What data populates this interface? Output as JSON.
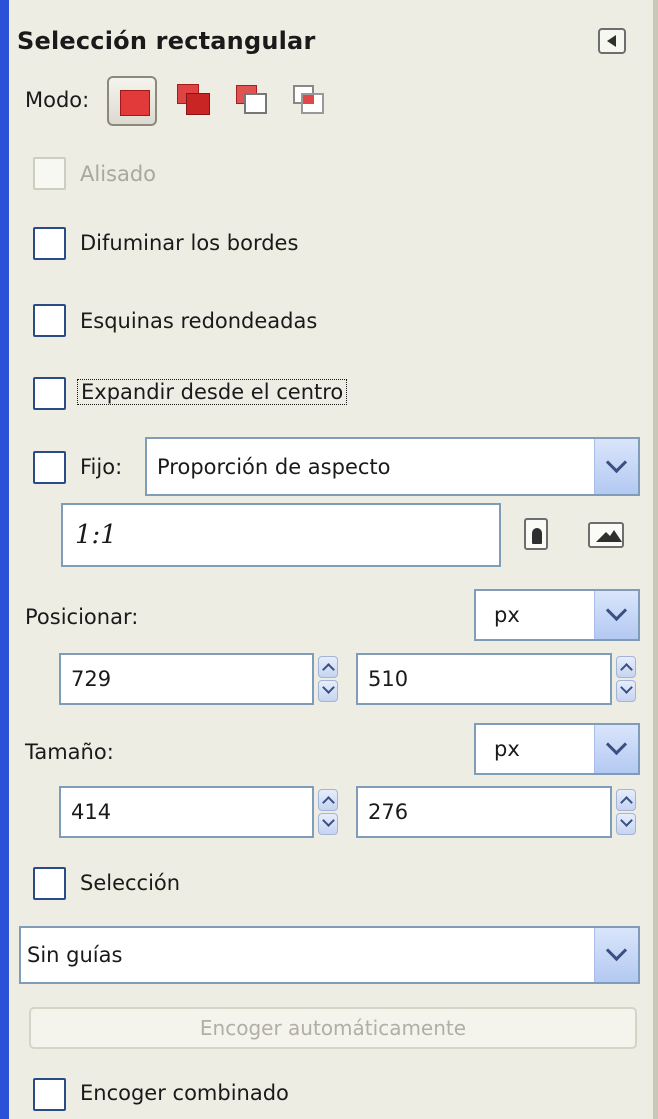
{
  "panel": {
    "title": "Selección rectangular",
    "collapse_icon": "triangle-left-icon",
    "mode_label": "Modo:",
    "modes": [
      "replace-selection-icon",
      "add-selection-icon",
      "subtract-selection-icon",
      "intersect-selection-icon"
    ],
    "active_mode": "replace-selection-icon"
  },
  "options": {
    "antialias": {
      "label": "Alisado",
      "checked": false,
      "enabled": false
    },
    "feather": {
      "label": "Difuminar los bordes",
      "checked": false
    },
    "rounded": {
      "label": "Esquinas redondeadas",
      "checked": false
    },
    "expand": {
      "label": "Expandir desde el centro",
      "checked": false
    },
    "fixed": {
      "label": "Fijo:",
      "checked": false,
      "value": "Proporción de aspecto"
    },
    "ratio": {
      "value": "1:1",
      "portrait_icon": "portrait-icon",
      "landscape_icon": "landscape-icon"
    }
  },
  "position": {
    "label": "Posicionar:",
    "unit": "px",
    "x": "729",
    "y": "510"
  },
  "size": {
    "label": "Tamaño:",
    "unit": "px",
    "w": "414",
    "h": "276"
  },
  "highlight": {
    "label": "Selección",
    "checked": false
  },
  "guides": {
    "value": "Sin guías"
  },
  "autoshrink": {
    "label": "Encoger automáticamente",
    "enabled": false
  },
  "shrink_merged": {
    "label": "Encoger combinado",
    "checked": false
  },
  "colors": {
    "accent": "#2b51d6",
    "mode_red": "#e23a3a",
    "field_border": "#7f9db9"
  }
}
